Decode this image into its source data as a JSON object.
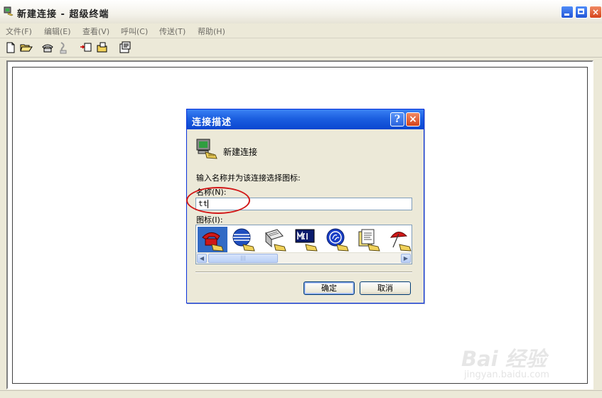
{
  "window": {
    "title": "新建连接 - 超级终端",
    "icon": "hyperterminal-icon"
  },
  "menu": [
    "文件(F)",
    "编辑(E)",
    "查看(V)",
    "呼叫(C)",
    "传送(T)",
    "帮助(H)"
  ],
  "toolbar": [
    "new-icon",
    "open-icon",
    "dial-icon",
    "disconnect-icon",
    "send-icon",
    "receive-icon",
    "properties-icon"
  ],
  "dialog": {
    "title": "连接描述",
    "help_label": "?",
    "close_label": "×",
    "connection_name": "新建连接",
    "prompt": "输入名称并为该连接选择图标:",
    "name_label": "名称(N):",
    "name_value": "tt",
    "icon_label": "图标(I):",
    "icons": [
      "phone-icon",
      "att-globe-icon",
      "fax-icon",
      "mci-icon",
      "ge-icon",
      "document-icon",
      "umbrella-icon"
    ],
    "selected_icon": 0,
    "scroll_thumb": "|||",
    "ok_label": "确定",
    "cancel_label": "取消"
  },
  "watermark": {
    "main": "Bai 经验",
    "sub": "jingyan.baidu.com"
  },
  "colors": {
    "dialog_title": "#0a46d0",
    "selection": "#316ac5",
    "annotation": "#d21818"
  }
}
